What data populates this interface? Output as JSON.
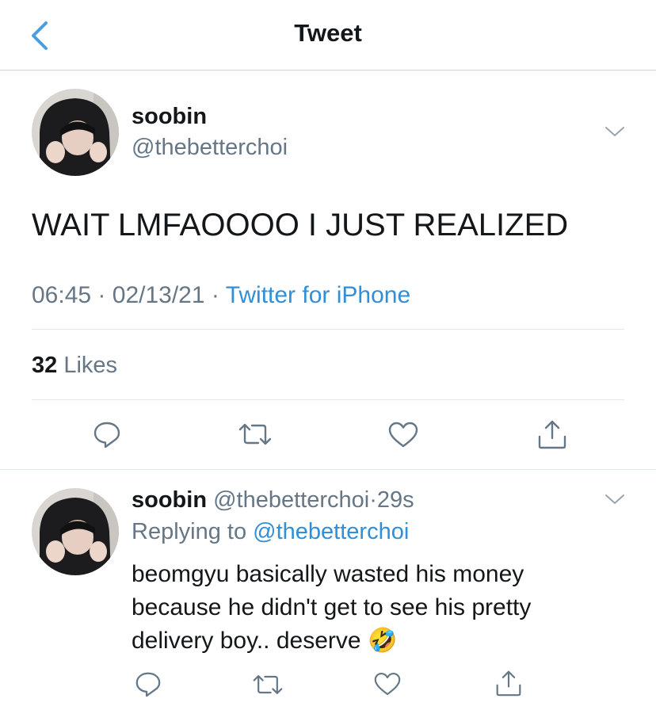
{
  "header": {
    "title": "Tweet"
  },
  "main_tweet": {
    "author_name": "soobin",
    "author_handle": "@thebetterchoi",
    "text": "WAIT LMFAOOOO I JUST REALIZED",
    "time": "06:45",
    "sep1": "·",
    "date": "02/13/21",
    "sep2": "·",
    "source": "Twitter for iPhone",
    "likes_count": "32",
    "likes_label": "Likes"
  },
  "reply_tweet": {
    "author_name": "soobin",
    "author_handle": "@thebetterchoi",
    "sep": "·",
    "age": "29s",
    "replying_prefix": "Replying to",
    "replying_handle": "@thebetterchoi",
    "text": "beomgyu basically wasted his money because he didn't get to see his pretty delivery boy.. deserve",
    "emoji": "🤣"
  },
  "icons": [
    "back-chevron-icon",
    "chevron-down-icon",
    "reply-icon",
    "retweet-icon",
    "like-icon",
    "share-icon"
  ],
  "colors": {
    "accent": "#2f8fd8",
    "text": "#14171a",
    "secondary": "#657786",
    "divider": "#e1e8ed"
  }
}
